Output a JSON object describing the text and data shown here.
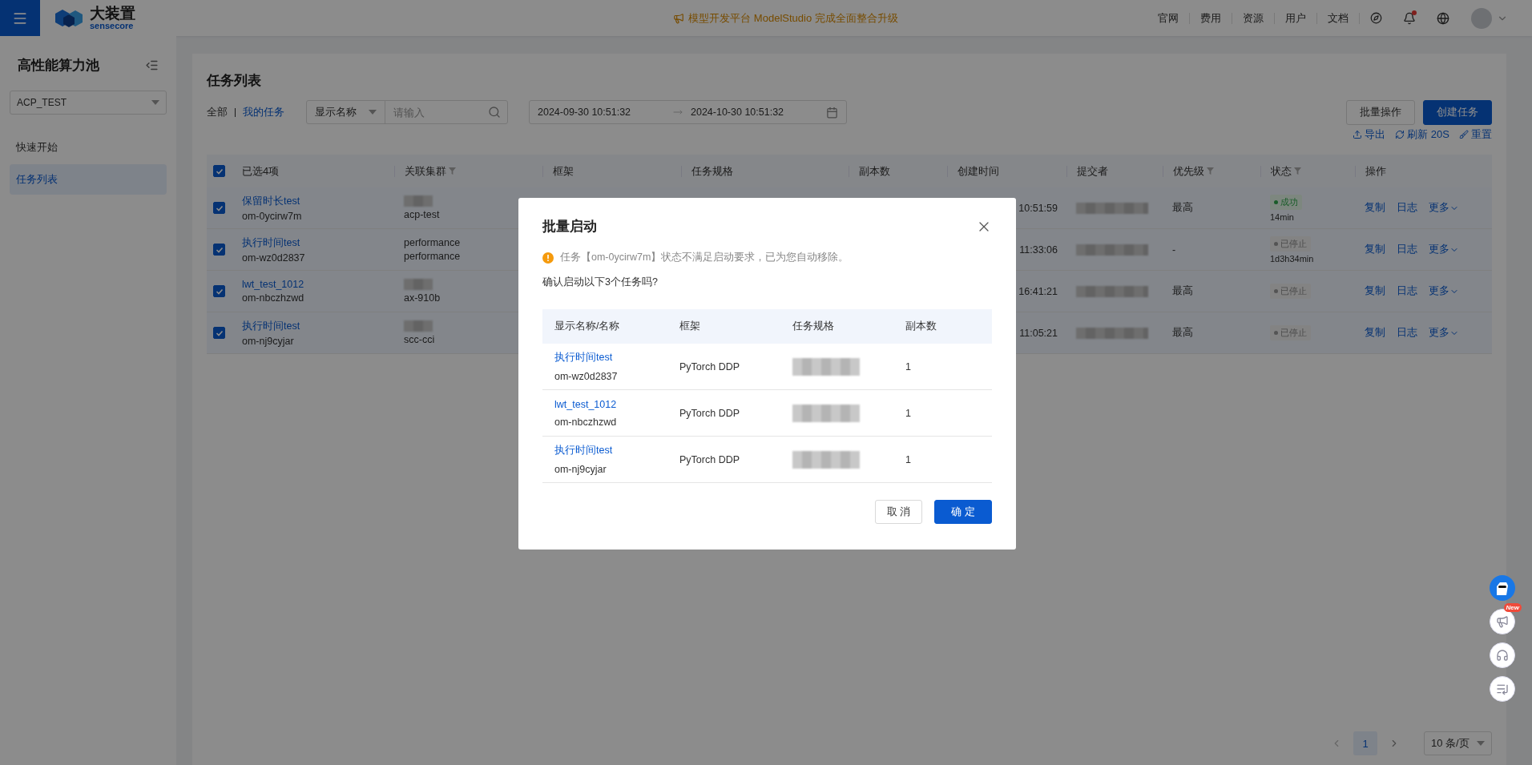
{
  "header": {
    "brand": {
      "name": "大装置",
      "sub": "sensecore"
    },
    "announcement": "模型开发平台 ModelStudio 完成全面整合升级",
    "nav_links": [
      "官网",
      "费用",
      "资源",
      "用户",
      "文档"
    ]
  },
  "sidebar": {
    "title": "高性能算力池",
    "pool_select": "ACP_TEST",
    "items": [
      {
        "label": "快速开始",
        "selected": false
      },
      {
        "label": "任务列表",
        "selected": true
      }
    ]
  },
  "page": {
    "title": "任务列表",
    "scope_tabs": [
      {
        "label": "全部",
        "selected": false
      },
      {
        "label": "我的任务",
        "selected": true
      }
    ],
    "filter": {
      "field": "显示名称",
      "placeholder": "请输入"
    },
    "date_range": {
      "start": "2024-09-30 10:51:32",
      "end": "2024-10-30 10:51:32"
    },
    "buttons": {
      "batch": "批量操作",
      "create": "创建任务"
    },
    "tools": [
      {
        "kind": "export",
        "label": "导出"
      },
      {
        "kind": "refresh",
        "label": "刷新 20S"
      },
      {
        "kind": "reset",
        "label": "重置"
      }
    ]
  },
  "table": {
    "all_checked": true,
    "columns": [
      {
        "label": "已选4项",
        "filter": false
      },
      {
        "label": "关联集群",
        "filter": true
      },
      {
        "label": "框架",
        "filter": false
      },
      {
        "label": "任务规格",
        "filter": false
      },
      {
        "label": "副本数",
        "filter": false
      },
      {
        "label": "创建时间",
        "filter": false
      },
      {
        "label": "提交者",
        "filter": false
      },
      {
        "label": "优先级",
        "filter": true
      },
      {
        "label": "状态",
        "filter": true
      },
      {
        "label": "操作",
        "filter": false
      }
    ],
    "rows": [
      {
        "checked": true,
        "name": "保留时长test",
        "id": "om-0ycirw7m",
        "cluster": [
          {
            "kind": "redacted"
          },
          {
            "kind": "text",
            "text": "acp-test"
          }
        ],
        "created": "10:51:59",
        "priority": "最高",
        "status": {
          "kind": "success",
          "label": "成功",
          "duration": "14min"
        },
        "actions": [
          "复制",
          "日志",
          "更多"
        ]
      },
      {
        "checked": true,
        "name": "执行时间test",
        "id": "om-wz0d2837",
        "cluster": [
          {
            "kind": "text",
            "text": "performance"
          },
          {
            "kind": "text",
            "text": "performance"
          }
        ],
        "created": "11:33:06",
        "priority": "-",
        "status": {
          "kind": "stopped",
          "label": "已停止",
          "duration": "1d3h34min"
        },
        "actions": [
          "复制",
          "日志",
          "更多"
        ]
      },
      {
        "checked": true,
        "name": "lwt_test_1012",
        "id": "om-nbczhzwd",
        "cluster": [
          {
            "kind": "redacted"
          },
          {
            "kind": "text",
            "text": "ax-910b"
          }
        ],
        "created": "16:41:21",
        "priority": "最高",
        "status": {
          "kind": "stopped",
          "label": "已停止"
        },
        "actions": [
          "复制",
          "日志",
          "更多"
        ]
      },
      {
        "checked": true,
        "name": "执行时间test",
        "id": "om-nj9cyjar",
        "cluster": [
          {
            "kind": "redacted"
          },
          {
            "kind": "text",
            "text": "scc-cci"
          }
        ],
        "created": "11:05:21",
        "priority": "最高",
        "status": {
          "kind": "stopped",
          "label": "已停止"
        },
        "actions": [
          "复制",
          "日志",
          "更多"
        ]
      }
    ]
  },
  "pagination": {
    "pages": [
      {
        "label": "1",
        "selected": true
      }
    ],
    "page_size": "10 条/页"
  },
  "dialog": {
    "title": "批量启动",
    "warning": "任务【om-0ycirw7m】状态不满足启动要求，已为您自动移除。",
    "question": "确认启动以下3个任务吗?",
    "columns": [
      "显示名称/名称",
      "框架",
      "任务规格",
      "副本数"
    ],
    "rows": [
      {
        "name": "执行时间test",
        "id": "om-wz0d2837",
        "framework": "PyTorch DDP",
        "replicas": "1"
      },
      {
        "name": "lwt_test_1012",
        "id": "om-nbczhzwd",
        "framework": "PyTorch DDP",
        "replicas": "1"
      },
      {
        "name": "执行时间test",
        "id": "om-nj9cyjar",
        "framework": "PyTorch DDP",
        "replicas": "1"
      }
    ],
    "cancel": "取 消",
    "confirm": "确 定"
  },
  "floating": {
    "badge": "New"
  }
}
